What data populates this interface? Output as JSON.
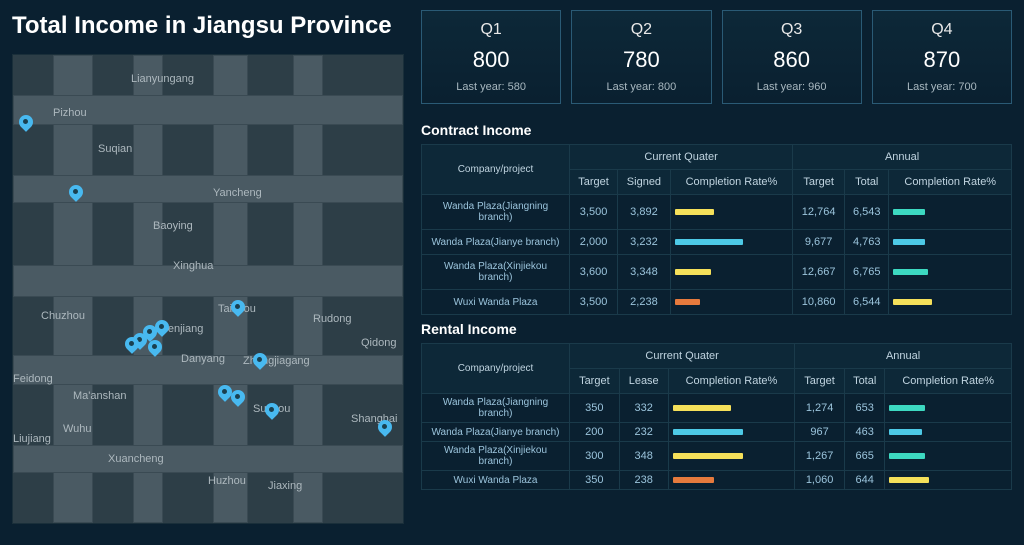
{
  "title": "Total Income in Jiangsu Province",
  "quarters": [
    {
      "label": "Q1",
      "value": "800",
      "lastyear": "Last year: 580"
    },
    {
      "label": "Q2",
      "value": "780",
      "lastyear": "Last year: 800"
    },
    {
      "label": "Q3",
      "value": "860",
      "lastyear": "Last year: 960"
    },
    {
      "label": "Q4",
      "value": "870",
      "lastyear": "Last year: 700"
    }
  ],
  "contract": {
    "title": "Contract Income",
    "headers": {
      "company": "Company/project",
      "cq": "Current Quater",
      "annual": "Annual",
      "target": "Target",
      "signed": "Signed",
      "total": "Total",
      "rate": "Completion Rate%"
    },
    "rows": [
      {
        "company": "Wanda Plaza(Jiangning branch)",
        "cq_target": "3,500",
        "cq_signed": "3,892",
        "cq_bar": 35,
        "cq_color": "#f5e05a",
        "a_target": "12,764",
        "a_total": "6,543",
        "a_bar": 28,
        "a_color": "#3dd9c1"
      },
      {
        "company": "Wanda Plaza(Jianye branch)",
        "cq_target": "2,000",
        "cq_signed": "3,232",
        "cq_bar": 60,
        "cq_color": "#4dc9e6",
        "a_target": "9,677",
        "a_total": "4,763",
        "a_bar": 28,
        "a_color": "#4dc9e6"
      },
      {
        "company": "Wanda Plaza(Xinjiekou branch)",
        "cq_target": "3,600",
        "cq_signed": "3,348",
        "cq_bar": 32,
        "cq_color": "#f5e05a",
        "a_target": "12,667",
        "a_total": "6,765",
        "a_bar": 30,
        "a_color": "#3dd9c1"
      },
      {
        "company": "Wuxi Wanda Plaza",
        "cq_target": "3,500",
        "cq_signed": "2,238",
        "cq_bar": 22,
        "cq_color": "#e67a3d",
        "a_target": "10,860",
        "a_total": "6,544",
        "a_bar": 34,
        "a_color": "#f5e05a"
      }
    ]
  },
  "rental": {
    "title": "Rental Income",
    "headers": {
      "company": "Company/project",
      "cq": "Current Quater",
      "annual": "Annual",
      "target": "Target",
      "lease": "Lease",
      "total": "Total",
      "rate": "Completion Rate%"
    },
    "rows": [
      {
        "company": "Wanda Plaza(Jiangning branch)",
        "cq_target": "350",
        "cq_lease": "332",
        "cq_bar": 50,
        "cq_color": "#f5e05a",
        "a_target": "1,274",
        "a_total": "653",
        "a_bar": 30,
        "a_color": "#3dd9c1"
      },
      {
        "company": "Wanda Plaza(Jianye branch)",
        "cq_target": "200",
        "cq_lease": "232",
        "cq_bar": 60,
        "cq_color": "#4dc9e6",
        "a_target": "967",
        "a_total": "463",
        "a_bar": 28,
        "a_color": "#4dc9e6"
      },
      {
        "company": "Wanda Plaza(Xinjiekou branch)",
        "cq_target": "300",
        "cq_lease": "348",
        "cq_bar": 60,
        "cq_color": "#f5e05a",
        "a_target": "1,267",
        "a_total": "665",
        "a_bar": 30,
        "a_color": "#3dd9c1"
      },
      {
        "company": "Wuxi Wanda Plaza",
        "cq_target": "350",
        "cq_lease": "238",
        "cq_bar": 35,
        "cq_color": "#e67a3d",
        "a_target": "1,060",
        "a_total": "644",
        "a_bar": 34,
        "a_color": "#f5e05a"
      }
    ]
  },
  "map_cities": [
    "Lianyungang",
    "Pizhou",
    "Suqian",
    "Yancheng",
    "Baoying",
    "Xinghua",
    "Taizhou",
    "Chuzhou",
    "Rudong",
    "Zhenjiang",
    "Danyang",
    "Zhangjiagang",
    "Qidong",
    "Feidong",
    "Ma'anshan",
    "Wuhu",
    "Suzhou",
    "Xuancheng",
    "Huzhou",
    "Jiaxing",
    "Shanghai",
    "Liujiang"
  ]
}
